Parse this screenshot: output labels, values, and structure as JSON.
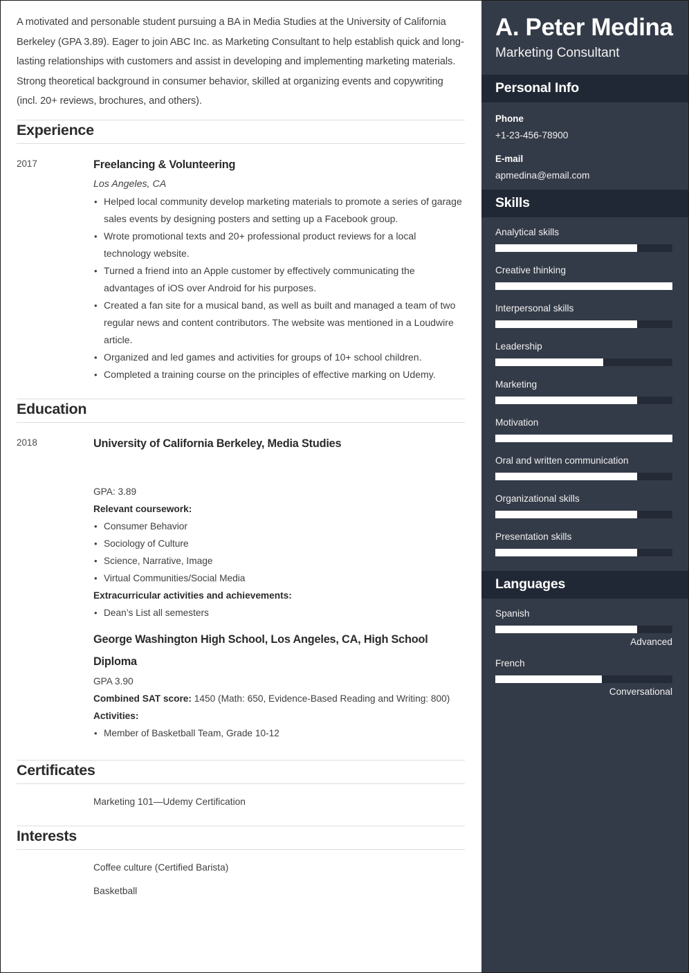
{
  "colors": {
    "sidebar_bg": "#343b48",
    "sidebar_band_bg": "#212835",
    "bar_track": "#242a36",
    "bar_fill": "#ffffff",
    "page_bg": "#ffffff",
    "rule": "#dddddd"
  },
  "main": {
    "summary": "A motivated and personable student pursuing a BA in Media Studies at the University of California Berkeley (GPA 3.89). Eager to join ABC Inc. as Marketing Consultant to help establish quick and long-lasting relationships with customers and assist in developing and implementing marketing materials. Strong theoretical background in consumer behavior, skilled at organizing events and copywriting (incl. 20+ reviews, brochures, and others).",
    "experience": {
      "heading": "Experience",
      "entries": [
        {
          "date": "2017",
          "title": "Freelancing & Volunteering",
          "subtitle": "Los Angeles, CA",
          "bullets": [
            "Helped local community develop marketing materials to promote a series of garage sales events by designing posters and setting up a Facebook group.",
            "Wrote promotional texts and 20+ professional product reviews for a local technology website.",
            "Turned a friend into an Apple customer by effectively communicating the advantages of iOS over Android for his purposes.",
            "Created a fan site for a musical band, as well as built and managed a team of two regular news and content contributors. The website was mentioned in a Loudwire article.",
            "Organized and led games and activities for groups of 10+ school children.",
            "Completed a training course on the principles of effective marking on Udemy."
          ]
        }
      ]
    },
    "education": {
      "heading": "Education",
      "entries": [
        {
          "date": "2018",
          "title": "University of California Berkeley, Media Studies",
          "subtitle": "",
          "gpa": "GPA: 3.89",
          "coursework_label": "Relevant coursework:",
          "coursework": [
            "Consumer Behavior",
            "Sociology of Culture",
            "Science, Narrative, Image",
            "Virtual Communities/Social Media"
          ],
          "extracurricular_label": "Extracurricular activities and achievements:",
          "extracurricular": [
            "Dean’s List all semesters"
          ]
        },
        {
          "date": "",
          "title": "George Washington High School, Los Angeles, CA, High School Diploma",
          "gpa": "GPA 3.90",
          "sat_label": "Combined SAT score:",
          "sat_value": " 1450 (Math: 650, Evidence-Based Reading and Writing: 800)",
          "activities_label": "Activities:",
          "activities": [
            "Member of Basketball Team, Grade 10-12"
          ]
        }
      ]
    },
    "certificates": {
      "heading": "Certificates",
      "items": [
        "Marketing 101—Udemy Certification"
      ]
    },
    "interests": {
      "heading": "Interests",
      "items": [
        "Coffee culture (Certified Barista)",
        "Basketball"
      ]
    }
  },
  "sidebar": {
    "name": "A. Peter Medina",
    "role": "Marketing Consultant",
    "personal_info": {
      "heading": "Personal Info",
      "fields": [
        {
          "label": "Phone",
          "value": "+1-23-456-78900"
        },
        {
          "label": "E-mail",
          "value": "apmedina@email.com"
        }
      ]
    },
    "skills": {
      "heading": "Skills",
      "items": [
        {
          "label": "Analytical skills",
          "level": 80
        },
        {
          "label": "Creative thinking",
          "level": 100
        },
        {
          "label": "Interpersonal skills",
          "level": 80
        },
        {
          "label": "Leadership",
          "level": 61
        },
        {
          "label": "Marketing",
          "level": 80
        },
        {
          "label": "Motivation",
          "level": 100
        },
        {
          "label": "Oral and written communication",
          "level": 80
        },
        {
          "label": "Organizational skills",
          "level": 80
        },
        {
          "label": "Presentation skills",
          "level": 80
        }
      ]
    },
    "languages": {
      "heading": "Languages",
      "items": [
        {
          "label": "Spanish",
          "level": 80,
          "proficiency": "Advanced"
        },
        {
          "label": "French",
          "level": 60,
          "proficiency": "Conversational"
        }
      ]
    }
  }
}
